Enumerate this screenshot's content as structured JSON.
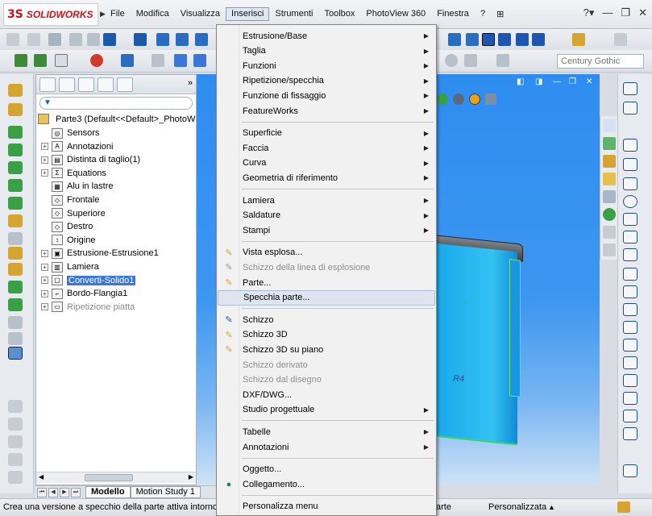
{
  "app": {
    "logo_mark": "3S",
    "logo_text": "SOLIDWORKS"
  },
  "menubar": {
    "items": [
      "File",
      "Modifica",
      "Visualizza",
      "Inserisci",
      "Strumenti",
      "Toolbox",
      "PhotoView 360",
      "Finestra",
      "?"
    ],
    "active_index": 3,
    "right_icons": [
      "help-icon",
      "minimize-icon",
      "restore-icon",
      "close-icon"
    ]
  },
  "toolbar": {
    "font_value": "Century Gothic"
  },
  "feature_manager": {
    "root_label": "Parte3  (Default<<Default>_PhotoW",
    "items": [
      {
        "label": "Sensors",
        "icon": "sensor-icon",
        "expandable": false,
        "state": "normal"
      },
      {
        "label": "Annotazioni",
        "icon": "annotation-icon",
        "expandable": true,
        "state": "normal"
      },
      {
        "label": "Distinta di taglio(1)",
        "icon": "cut-list-icon",
        "expandable": true,
        "state": "normal"
      },
      {
        "label": "Equations",
        "icon": "equations-icon",
        "expandable": true,
        "state": "normal"
      },
      {
        "label": "Alu in lastre",
        "icon": "material-icon",
        "expandable": false,
        "state": "normal"
      },
      {
        "label": "Frontale",
        "icon": "plane-icon",
        "expandable": false,
        "state": "normal"
      },
      {
        "label": "Superiore",
        "icon": "plane-icon",
        "expandable": false,
        "state": "normal"
      },
      {
        "label": "Destro",
        "icon": "plane-icon",
        "expandable": false,
        "state": "normal"
      },
      {
        "label": "Origine",
        "icon": "origin-icon",
        "expandable": false,
        "state": "normal"
      },
      {
        "label": "Estrusione-Estrusione1",
        "icon": "extrude-icon",
        "expandable": true,
        "state": "normal"
      },
      {
        "label": "Lamiera",
        "icon": "sheet-metal-icon",
        "expandable": true,
        "state": "normal"
      },
      {
        "label": "Converti-Solido1",
        "icon": "convert-solid-icon",
        "expandable": true,
        "state": "selected"
      },
      {
        "label": "Bordo-Flangia1",
        "icon": "edge-flange-icon",
        "expandable": true,
        "state": "normal"
      },
      {
        "label": "Ripetizione piatta",
        "icon": "flat-pattern-icon",
        "expandable": true,
        "state": "dim"
      }
    ]
  },
  "bottom_tabs": {
    "tabs": [
      "Modello",
      "Motion Study 1"
    ],
    "active_index": 0
  },
  "status": {
    "message": "Crea una versione a specchio della parte attiva intorno",
    "part_label": "arte",
    "customize_label": "Personalizzata"
  },
  "viewport": {
    "dimension_label": "R4"
  },
  "insert_menu": {
    "items": [
      {
        "type": "item",
        "label": "Estrusione/Base",
        "submenu": true,
        "icon": ""
      },
      {
        "type": "item",
        "label": "Taglia",
        "submenu": true,
        "icon": ""
      },
      {
        "type": "item",
        "label": "Funzioni",
        "submenu": true,
        "icon": ""
      },
      {
        "type": "item",
        "label": "Ripetizione/specchia",
        "submenu": true,
        "icon": ""
      },
      {
        "type": "item",
        "label": "Funzione di fissaggio",
        "submenu": true,
        "icon": ""
      },
      {
        "type": "item",
        "label": "FeatureWorks",
        "submenu": true,
        "icon": ""
      },
      {
        "type": "sep"
      },
      {
        "type": "item",
        "label": "Superficie",
        "submenu": true,
        "icon": ""
      },
      {
        "type": "item",
        "label": "Faccia",
        "submenu": true,
        "icon": ""
      },
      {
        "type": "item",
        "label": "Curva",
        "submenu": true,
        "icon": ""
      },
      {
        "type": "item",
        "label": "Geometria di riferimento",
        "submenu": true,
        "icon": ""
      },
      {
        "type": "sep"
      },
      {
        "type": "item",
        "label": "Lamiera",
        "submenu": true,
        "icon": ""
      },
      {
        "type": "item",
        "label": "Saldature",
        "submenu": true,
        "icon": ""
      },
      {
        "type": "item",
        "label": "Stampi",
        "submenu": true,
        "icon": ""
      },
      {
        "type": "sep"
      },
      {
        "type": "item",
        "label": "Vista esplosa...",
        "submenu": false,
        "icon": "exploded-view-icon"
      },
      {
        "type": "item",
        "label": "Schizzo della linea di esplosione",
        "submenu": false,
        "icon": "explode-line-icon",
        "disabled": true
      },
      {
        "type": "item",
        "label": "Parte...",
        "submenu": false,
        "icon": "part-icon"
      },
      {
        "type": "item",
        "label": "Specchia parte...",
        "submenu": false,
        "icon": "",
        "highlight": true
      },
      {
        "type": "sep"
      },
      {
        "type": "item",
        "label": "Schizzo",
        "submenu": false,
        "icon": "sketch-icon"
      },
      {
        "type": "item",
        "label": "Schizzo 3D",
        "submenu": false,
        "icon": "sketch-3d-icon"
      },
      {
        "type": "item",
        "label": "Schizzo 3D su piano",
        "submenu": false,
        "icon": "sketch-3d-plane-icon"
      },
      {
        "type": "item",
        "label": "Schizzo derivato",
        "submenu": false,
        "icon": "",
        "disabled": true
      },
      {
        "type": "item",
        "label": "Schizzo dal disegno",
        "submenu": false,
        "icon": "",
        "disabled": true
      },
      {
        "type": "item",
        "label": "DXF/DWG...",
        "submenu": false,
        "icon": ""
      },
      {
        "type": "item",
        "label": "Studio progettuale",
        "submenu": true,
        "icon": ""
      },
      {
        "type": "sep"
      },
      {
        "type": "item",
        "label": "Tabelle",
        "submenu": true,
        "icon": ""
      },
      {
        "type": "item",
        "label": "Annotazioni",
        "submenu": true,
        "icon": ""
      },
      {
        "type": "sep"
      },
      {
        "type": "item",
        "label": "Oggetto...",
        "submenu": false,
        "icon": ""
      },
      {
        "type": "item",
        "label": "Collegamento...",
        "submenu": false,
        "icon": "hyperlink-icon"
      },
      {
        "type": "sep"
      },
      {
        "type": "item",
        "label": "Personalizza menu",
        "submenu": false,
        "icon": ""
      }
    ]
  },
  "colors": {
    "brand": "#d0101a",
    "selection": "#3a77d6",
    "viewport_blue": "#2f8df0",
    "menu_highlight": "#dde5ef"
  }
}
